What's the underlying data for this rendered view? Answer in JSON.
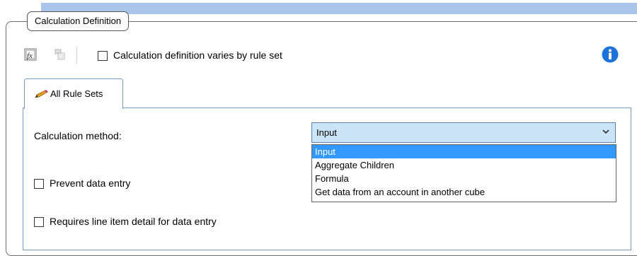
{
  "group": {
    "title": "Calculation Definition"
  },
  "toolbar": {
    "formula_icon": "formula-icon",
    "rule_icon": "rule-icon",
    "varies_label": "Calculation definition varies by rule set",
    "varies_checked": false,
    "info_icon": "info-icon"
  },
  "tabs": [
    {
      "label": "All Rule Sets",
      "icon": "pencil-icon",
      "active": true
    }
  ],
  "calculation_method": {
    "label": "Calculation method:",
    "selected": "Input",
    "options": [
      "Input",
      "Aggregate Children",
      "Formula",
      "Get data from an account in another cube"
    ]
  },
  "checkboxes": {
    "prevent_label": "Prevent data entry",
    "prevent_checked": false,
    "line_item_label": "Requires line item detail for data entry",
    "line_item_checked": false
  },
  "colors": {
    "select_bg": "#cbe4f7",
    "highlight": "#3399ff",
    "info_blue": "#1e73d8",
    "band": "#a9c6ea"
  }
}
